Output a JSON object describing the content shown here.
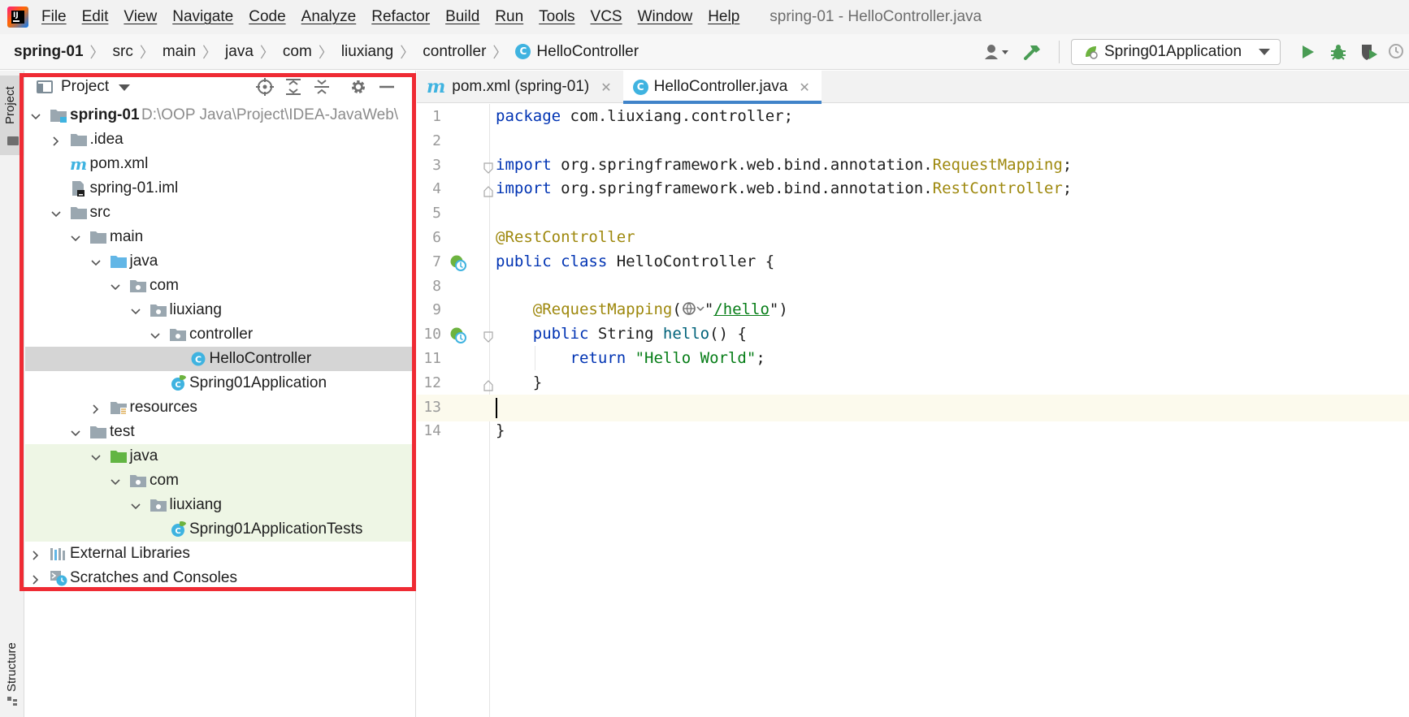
{
  "window": {
    "title": "spring-01 - HelloController.java"
  },
  "menu": [
    "File",
    "Edit",
    "View",
    "Navigate",
    "Code",
    "Analyze",
    "Refactor",
    "Build",
    "Run",
    "Tools",
    "VCS",
    "Window",
    "Help"
  ],
  "breadcrumb": [
    "spring-01",
    "src",
    "main",
    "java",
    "com",
    "liuxiang",
    "controller",
    "HelloController"
  ],
  "toolbar": {
    "run_config": "Spring01Application"
  },
  "left_strip": {
    "project": "Project",
    "structure": "Structure"
  },
  "project_panel": {
    "title": "Project",
    "tree": [
      {
        "label": "spring-01",
        "path": "D:\\OOP Java\\Project\\IDEA-JavaWeb\\",
        "level": 0,
        "arrow": "down",
        "icon": "module"
      },
      {
        "label": ".idea",
        "level": 1,
        "arrow": "right",
        "icon": "folder"
      },
      {
        "label": "pom.xml",
        "level": 1,
        "arrow": "none",
        "icon": "maven"
      },
      {
        "label": "spring-01.iml",
        "level": 1,
        "arrow": "none",
        "icon": "iml"
      },
      {
        "label": "src",
        "level": 1,
        "arrow": "down",
        "icon": "folder"
      },
      {
        "label": "main",
        "level": 2,
        "arrow": "down",
        "icon": "folder"
      },
      {
        "label": "java",
        "level": 3,
        "arrow": "down",
        "icon": "source-folder"
      },
      {
        "label": "com",
        "level": 4,
        "arrow": "down",
        "icon": "package"
      },
      {
        "label": "liuxiang",
        "level": 5,
        "arrow": "down",
        "icon": "package"
      },
      {
        "label": "controller",
        "level": 6,
        "arrow": "down",
        "icon": "package"
      },
      {
        "label": "HelloController",
        "level": 7,
        "arrow": "none",
        "icon": "class",
        "selected": true
      },
      {
        "label": "Spring01Application",
        "level": 6,
        "arrow": "none",
        "icon": "spring-class"
      },
      {
        "label": "resources",
        "level": 3,
        "arrow": "right",
        "icon": "resources-folder"
      },
      {
        "label": "test",
        "level": 2,
        "arrow": "down",
        "icon": "folder"
      },
      {
        "label": "java",
        "level": 3,
        "arrow": "down",
        "icon": "test-folder",
        "test": true
      },
      {
        "label": "com",
        "level": 4,
        "arrow": "down",
        "icon": "package",
        "test": true
      },
      {
        "label": "liuxiang",
        "level": 5,
        "arrow": "down",
        "icon": "package",
        "test": true
      },
      {
        "label": "Spring01ApplicationTests",
        "level": 6,
        "arrow": "none",
        "icon": "spring-class",
        "test": true
      },
      {
        "label": "External Libraries",
        "level": 0,
        "arrow": "right",
        "icon": "libraries"
      },
      {
        "label": "Scratches and Consoles",
        "level": 0,
        "arrow": "right",
        "icon": "scratches"
      }
    ]
  },
  "editor": {
    "tabs": [
      {
        "label": "pom.xml (spring-01)",
        "icon": "maven",
        "active": false
      },
      {
        "label": "HelloController.java",
        "icon": "class",
        "active": true
      }
    ],
    "current_line": 13,
    "lines": [
      [
        {
          "t": "package ",
          "c": "kw"
        },
        {
          "t": "com.liuxiang.controller;"
        }
      ],
      [],
      [
        {
          "t": "import ",
          "c": "kw"
        },
        {
          "t": "org.springframework.web.bind.annotation."
        },
        {
          "t": "RequestMapping",
          "c": "ann"
        },
        {
          "t": ";"
        }
      ],
      [
        {
          "t": "import ",
          "c": "kw"
        },
        {
          "t": "org.springframework.web.bind.annotation."
        },
        {
          "t": "RestController",
          "c": "ann"
        },
        {
          "t": ";"
        }
      ],
      [],
      [
        {
          "t": "@RestController",
          "c": "ann"
        }
      ],
      [
        {
          "t": "public class ",
          "c": "kw"
        },
        {
          "t": "HelloController {"
        }
      ],
      [],
      [
        {
          "t": "    "
        },
        {
          "t": "@RequestMapping",
          "c": "ann"
        },
        {
          "t": "("
        },
        {
          "t": "",
          "c": "globe"
        },
        {
          "t": "\""
        },
        {
          "t": "/hello",
          "c": "url"
        },
        {
          "t": "\""
        },
        {
          "t": ")"
        }
      ],
      [
        {
          "t": "    "
        },
        {
          "t": "public ",
          "c": "kw"
        },
        {
          "t": "String "
        },
        {
          "t": "hello",
          "c": "fn"
        },
        {
          "t": "() {"
        }
      ],
      [
        {
          "t": "        "
        },
        {
          "t": "return ",
          "c": "kw"
        },
        {
          "t": "\"Hello World\"",
          "c": "str"
        },
        {
          "t": ";"
        }
      ],
      [
        {
          "t": "    }"
        }
      ],
      [],
      [
        {
          "t": "}"
        }
      ]
    ]
  },
  "colors": {
    "highlight_border": "#ef2b34",
    "keyword": "#0033b3",
    "annotation": "#9e880d",
    "string": "#067d17",
    "selection": "#d5d5d5",
    "test_background": "#eef6e5",
    "active_tab_underline": "#4083c9"
  }
}
